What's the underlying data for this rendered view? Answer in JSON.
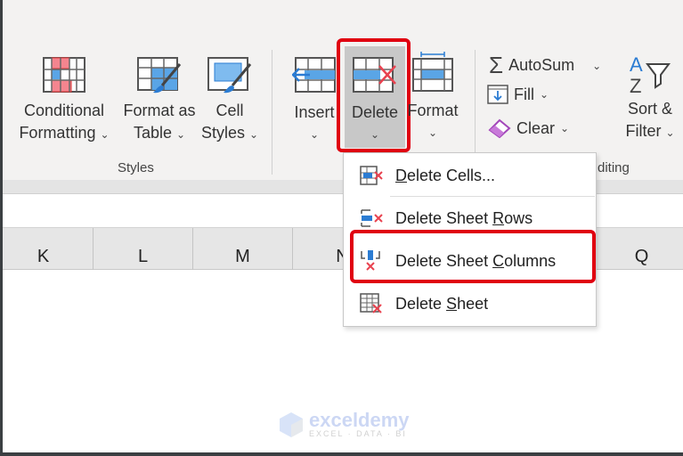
{
  "ribbon": {
    "styles_group": {
      "label": "Styles",
      "buttons": [
        {
          "label1": "Conditional",
          "label2": "Formatting",
          "icon": "conditional-formatting-icon"
        },
        {
          "label1": "Format as",
          "label2": "Table",
          "icon": "format-as-table-icon"
        },
        {
          "label1": "Cell",
          "label2": "Styles",
          "icon": "cell-styles-icon"
        }
      ]
    },
    "cells_group": {
      "buttons": [
        {
          "label": "Insert",
          "icon": "insert-cells-icon"
        },
        {
          "label": "Delete",
          "icon": "delete-cells-icon",
          "highlighted": true
        },
        {
          "label": "Format",
          "icon": "format-cells-icon"
        }
      ]
    },
    "editing_group": {
      "label": "Editing",
      "partial_label": "diting",
      "autosum": "AutoSum",
      "fill": "Fill",
      "clear": "Clear",
      "sort1": "Sort &",
      "sort2": "Filter"
    }
  },
  "columns": [
    "K",
    "L",
    "M",
    "N",
    "Q"
  ],
  "delete_menu": {
    "items": [
      {
        "label": "Delete Cells...",
        "access_key": "D",
        "icon": "delete-cells-icon"
      },
      {
        "label": "Delete Sheet Rows",
        "access_key": "R",
        "icon": "delete-rows-icon"
      },
      {
        "label": "Delete Sheet Columns",
        "access_key": "C",
        "icon": "delete-columns-icon",
        "highlighted": true
      },
      {
        "label": "Delete Sheet",
        "access_key": "S",
        "icon": "delete-sheet-icon"
      }
    ]
  },
  "colors": {
    "highlight": "#e00010",
    "accent_blue": "#2b7cd3",
    "red_icon": "#e8424f"
  },
  "watermark": {
    "brand": "exceldemy",
    "tagline": "EXCEL · DATA · BI"
  }
}
